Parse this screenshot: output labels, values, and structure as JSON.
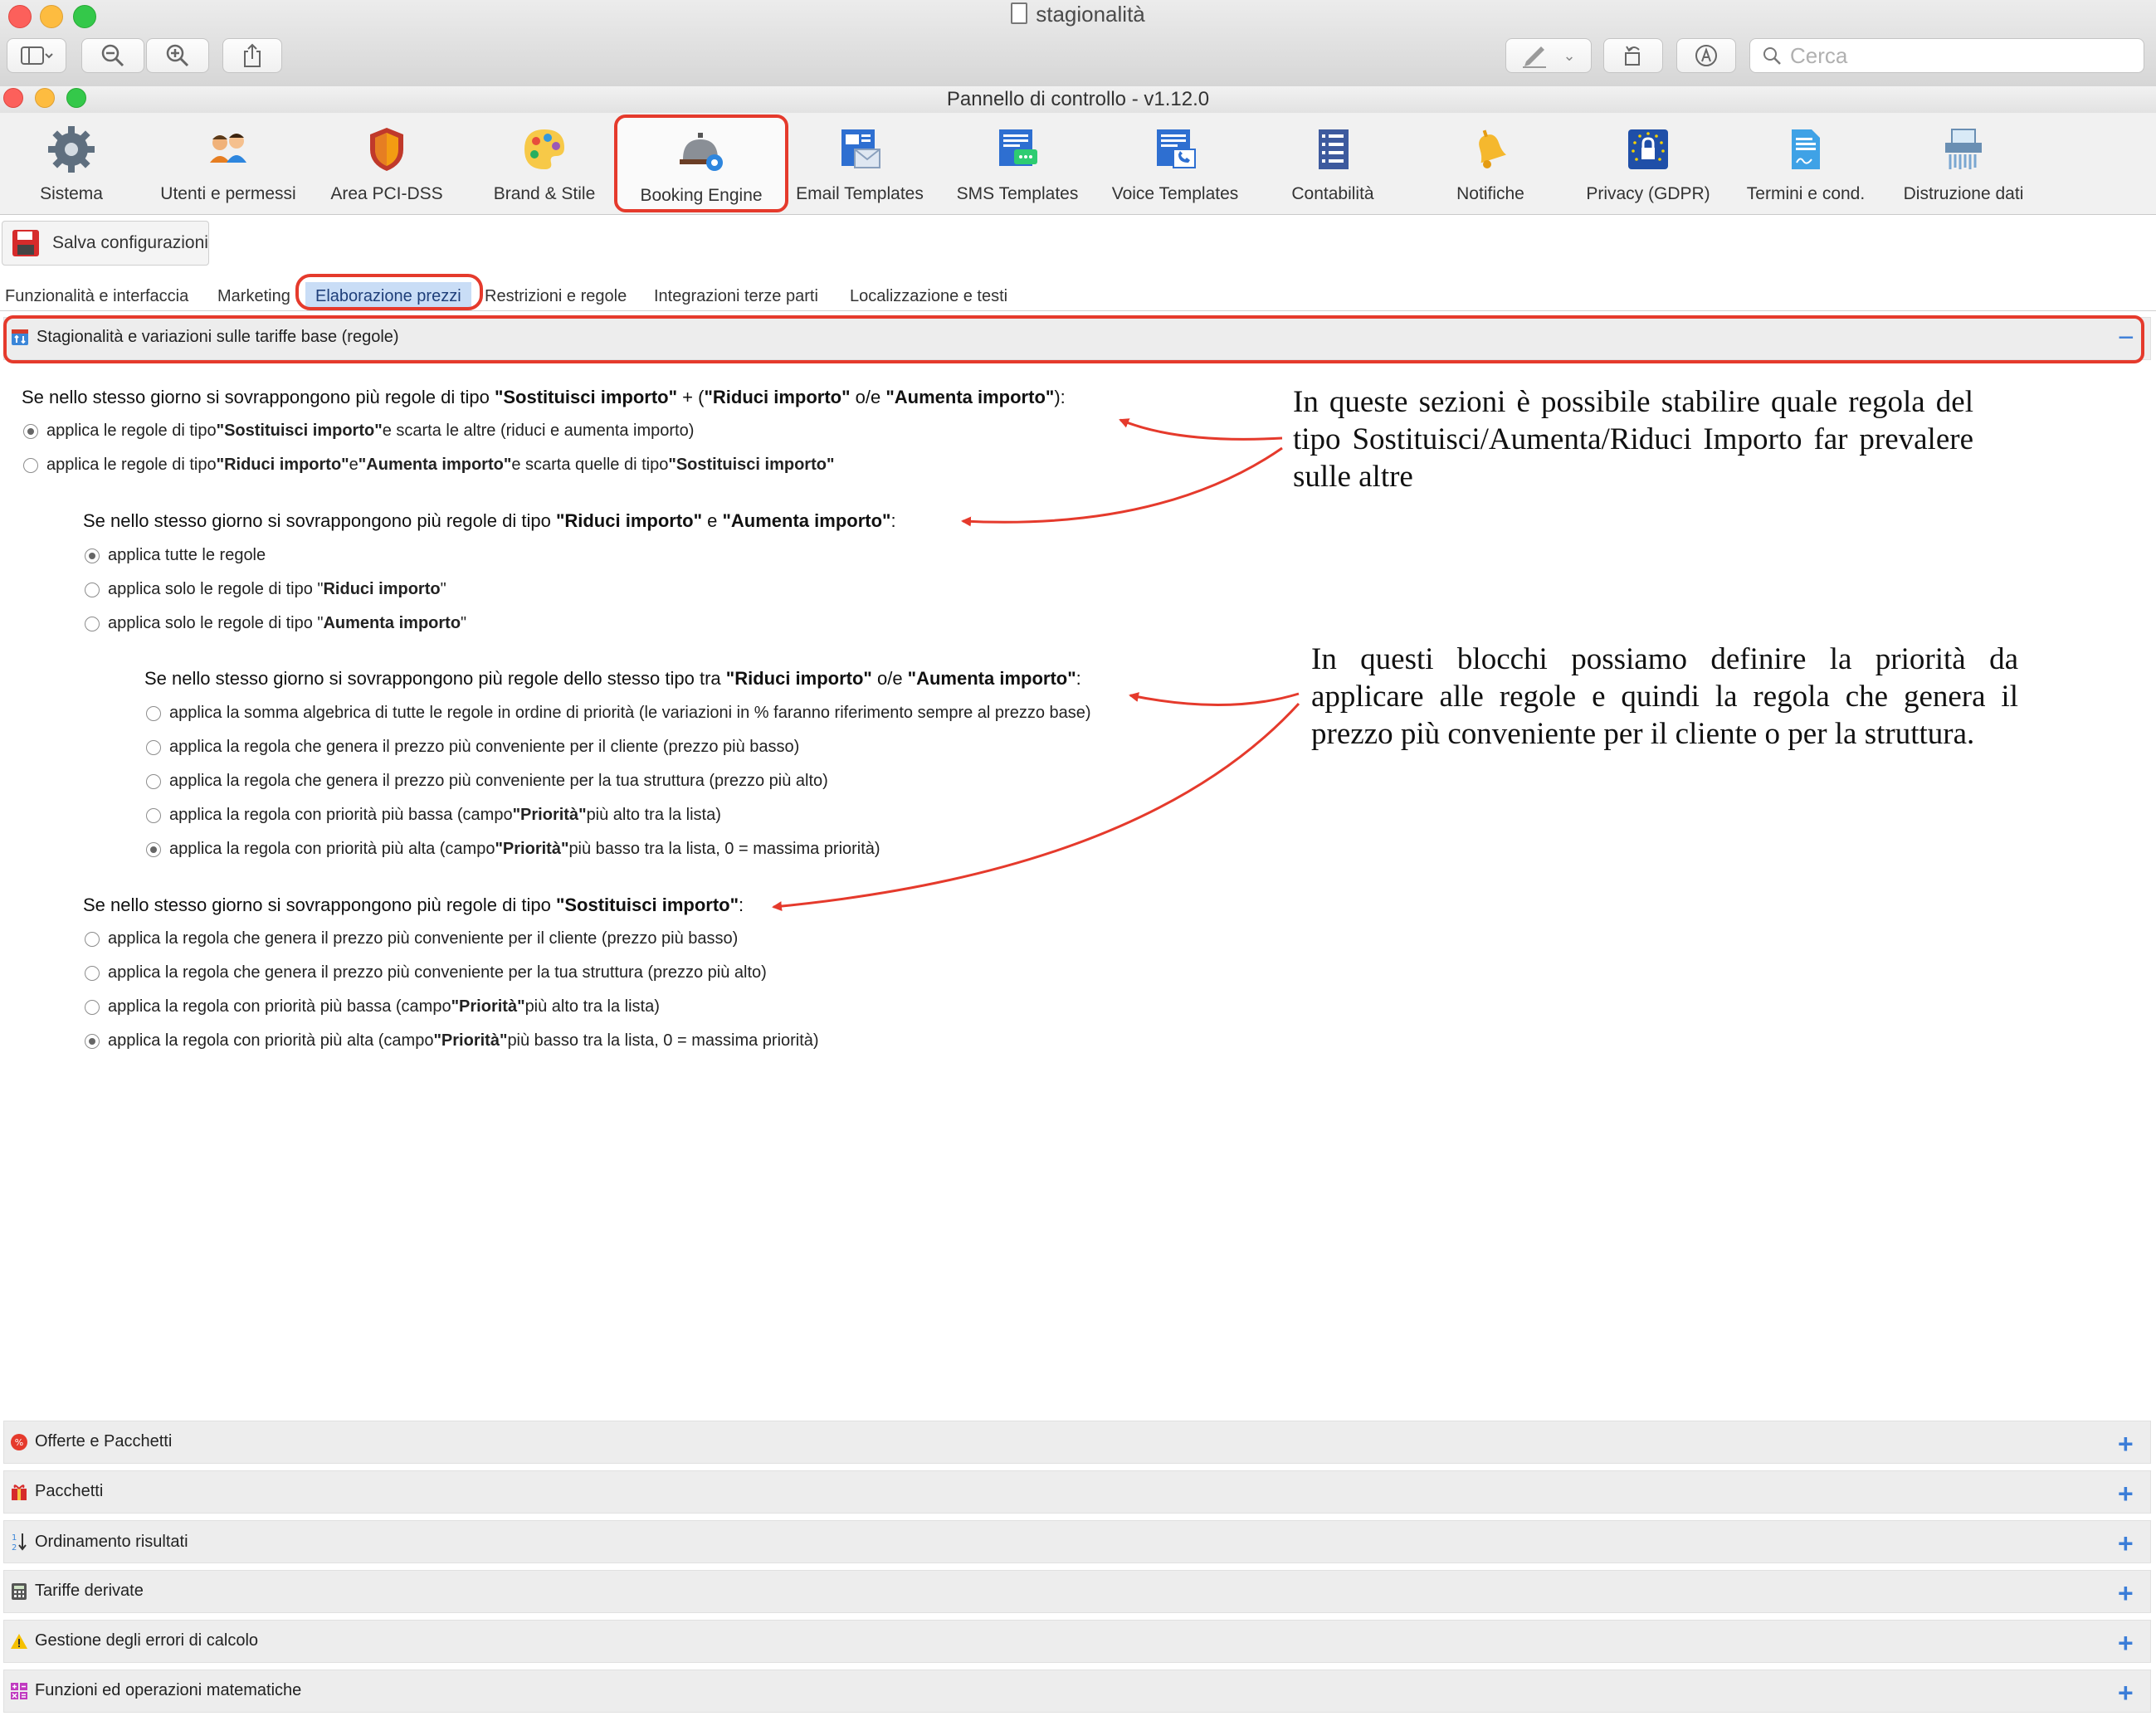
{
  "outer_window": {
    "title": "stagionalità",
    "search_placeholder": "Cerca"
  },
  "app": {
    "title": "Pannello di controllo - v1.12.0"
  },
  "toolbar": {
    "items": [
      {
        "label": "Sistema",
        "icon": "gear-icon"
      },
      {
        "label": "Utenti e permessi",
        "icon": "users-icon"
      },
      {
        "label": "Area PCI-DSS",
        "icon": "shield-icon"
      },
      {
        "label": "Brand & Stile",
        "icon": "palette-icon"
      },
      {
        "label": "Booking Engine",
        "icon": "reception-bell-icon"
      },
      {
        "label": "Email Templates",
        "icon": "email-template-icon"
      },
      {
        "label": "SMS Templates",
        "icon": "sms-template-icon"
      },
      {
        "label": "Voice Templates",
        "icon": "voice-template-icon"
      },
      {
        "label": "Contabilità",
        "icon": "ledger-icon"
      },
      {
        "label": "Notifiche",
        "icon": "bell-icon"
      },
      {
        "label": "Privacy (GDPR)",
        "icon": "gdpr-lock-icon"
      },
      {
        "label": "Termini e cond.",
        "icon": "contract-icon"
      },
      {
        "label": "Distruzione dati",
        "icon": "shredder-icon"
      }
    ],
    "active": "Booking Engine"
  },
  "save_button": {
    "label": "Salva configurazioni"
  },
  "tabs": [
    "Funzionalità e interfaccia",
    "Marketing",
    "Elaborazione prezzi",
    "Restrizioni e regole",
    "Integrazioni terze parti",
    "Localizzazione e testi"
  ],
  "active_tab": "Elaborazione prezzi",
  "main_section": {
    "title": "Stagionalità e variazioni sulle tariffe base (regole)",
    "collapse_symbol": "−",
    "q1": {
      "t1": "Se nello stesso giorno si sovrappongono più regole di tipo ",
      "b1": "\"Sostituisci importo\"",
      "t2": " + (",
      "b2": "\"Riduci importo\"",
      "t3": " o/e ",
      "b3": "\"Aumenta importo\"",
      "t4": "):",
      "opt1": {
        "t1": "applica le regole di tipo ",
        "b1": "\"Sostituisci importo\"",
        "t2": " e scarta le altre (riduci e aumenta importo)",
        "selected": true
      },
      "opt2": {
        "t1": "applica le regole di tipo ",
        "b1": "\"Riduci importo\"",
        "t2": " e ",
        "b2": "\"Aumenta importo\"",
        "t3": " e scarta quelle di tipo ",
        "b3": "\"Sostituisci importo\"",
        "selected": false
      }
    },
    "q2": {
      "t1": "Se nello stesso giorno si sovrappongono più regole di tipo ",
      "b1": "\"Riduci importo\"",
      "t2": " e ",
      "b2": "\"Aumenta importo\"",
      "t3": ":",
      "opt1": {
        "t1": "applica tutte le regole",
        "selected": true
      },
      "opt2": {
        "t1": "applica solo le regole di tipo \"",
        "b1": "Riduci importo",
        "t2": "\"",
        "selected": false
      },
      "opt3": {
        "t1": "applica solo le regole di tipo \"",
        "b1": "Aumenta importo",
        "t2": "\"",
        "selected": false
      }
    },
    "q3": {
      "t1": "Se nello stesso giorno si sovrappongono più regole dello stesso tipo tra ",
      "b1": "\"Riduci importo\"",
      "t2": " o/e ",
      "b2": "\"Aumenta importo\"",
      "t3": ":",
      "opt1": {
        "t1": "applica la somma algebrica di tutte le regole in ordine di priorità (le variazioni in % faranno riferimento sempre al prezzo base)",
        "selected": false
      },
      "opt2": {
        "t1": "applica la regola che genera il prezzo più conveniente per il cliente (prezzo più basso)",
        "selected": false
      },
      "opt3": {
        "t1": "applica la regola che genera il prezzo più conveniente per la tua struttura (prezzo più alto)",
        "selected": false
      },
      "opt4": {
        "t1": "applica la regola con priorità più bassa (campo ",
        "b1": "\"Priorità\"",
        "t2": " più alto tra la lista)",
        "selected": false
      },
      "opt5": {
        "t1": "applica la regola con priorità più alta (campo ",
        "b1": "\"Priorità\"",
        "t2": " più basso tra la lista, 0 = massima priorità)",
        "selected": true
      }
    },
    "q4": {
      "t1": "Se nello stesso giorno si sovrappongono più regole di tipo ",
      "b1": "\"Sostituisci importo\"",
      "t2": ":",
      "opt1": {
        "t1": "applica la regola che genera il prezzo più conveniente per il cliente (prezzo più basso)",
        "selected": false
      },
      "opt2": {
        "t1": "applica la regola che genera il prezzo più conveniente per la tua struttura (prezzo più alto)",
        "selected": false
      },
      "opt3": {
        "t1": "applica la regola con priorità più bassa (campo ",
        "b1": "\"Priorità\"",
        "t2": " più alto tra la lista)",
        "selected": false
      },
      "opt4": {
        "t1": "applica la regola con priorità più alta (campo ",
        "b1": "\"Priorità\"",
        "t2": " più basso tra la lista, 0 = massima priorità)",
        "selected": true
      }
    }
  },
  "annotations": {
    "note1": "In queste sezioni è possibile stabilire quale regola del tipo Sostituisci/Aumenta/Riduci Importo far prevalere sulle altre",
    "note2": "In questi blocchi possiamo definire la priorità da applicare alle regole e quindi la regola che genera il prezzo più conveniente per il cliente o per la struttura.",
    "color": "#e53a2c"
  },
  "collapsed_sections": [
    {
      "title": "Offerte e Pacchetti",
      "icon": "offer-badge-icon"
    },
    {
      "title": "Pacchetti",
      "icon": "gift-icon"
    },
    {
      "title": "Ordinamento risultati",
      "icon": "sort-icon"
    },
    {
      "title": "Tariffe derivate",
      "icon": "calculator-icon"
    },
    {
      "title": "Gestione degli errori di calcolo",
      "icon": "warning-icon"
    },
    {
      "title": "Funzioni ed operazioni matematiche",
      "icon": "functions-grid-icon"
    }
  ],
  "expand_symbol": "+"
}
